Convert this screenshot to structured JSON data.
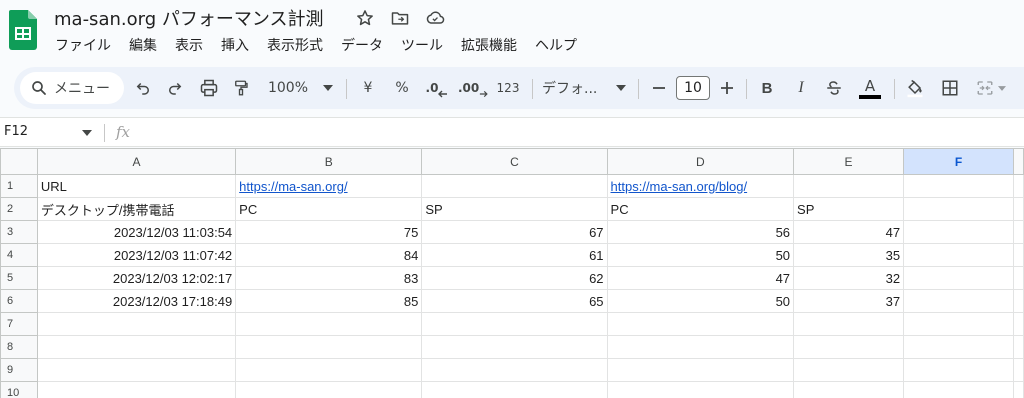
{
  "document": {
    "title": "ma-san.org パフォーマンス計測"
  },
  "menu": [
    "ファイル",
    "編集",
    "表示",
    "挿入",
    "表示形式",
    "データ",
    "ツール",
    "拡張機能",
    "ヘルプ"
  ],
  "toolbar": {
    "search_label": "メニュー",
    "zoom": "100%",
    "currency": "¥",
    "percent": "%",
    "decimal_decrease": ".0",
    "decimal_increase": ".00",
    "number_format": "123",
    "font": "デフォ...",
    "font_size": "10",
    "bold": "B",
    "italic": "I",
    "text_color_label": "A"
  },
  "formula_bar": {
    "cell_ref": "F12",
    "fx": "fx"
  },
  "sheet": {
    "columns": [
      "A",
      "B",
      "C",
      "D",
      "E",
      "F"
    ],
    "selected_column": "F",
    "rows": [
      {
        "n": "1",
        "cells": [
          "URL",
          "https://ma-san.org/",
          "",
          "https://ma-san.org/blog/",
          "",
          ""
        ]
      },
      {
        "n": "2",
        "cells": [
          "デスクトップ/携帯電話",
          "PC",
          "SP",
          "PC",
          "SP",
          ""
        ]
      },
      {
        "n": "3",
        "cells": [
          "2023/12/03 11:03:54",
          "75",
          "67",
          "56",
          "47",
          ""
        ]
      },
      {
        "n": "4",
        "cells": [
          "2023/12/03 11:07:42",
          "84",
          "61",
          "50",
          "35",
          ""
        ]
      },
      {
        "n": "5",
        "cells": [
          "2023/12/03 12:02:17",
          "83",
          "62",
          "47",
          "32",
          ""
        ]
      },
      {
        "n": "6",
        "cells": [
          "2023/12/03 17:18:49",
          "85",
          "65",
          "50",
          "37",
          ""
        ]
      },
      {
        "n": "7",
        "cells": [
          "",
          "",
          "",
          "",
          "",
          ""
        ]
      },
      {
        "n": "8",
        "cells": [
          "",
          "",
          "",
          "",
          "",
          ""
        ]
      },
      {
        "n": "9",
        "cells": [
          "",
          "",
          "",
          "",
          "",
          ""
        ]
      },
      {
        "n": "10",
        "cells": [
          "",
          "",
          "",
          "",
          "",
          ""
        ]
      }
    ]
  },
  "colors": {
    "sheets_green": "#0f9d58",
    "link": "#1155cc",
    "selected_header": "#d3e3fd"
  }
}
